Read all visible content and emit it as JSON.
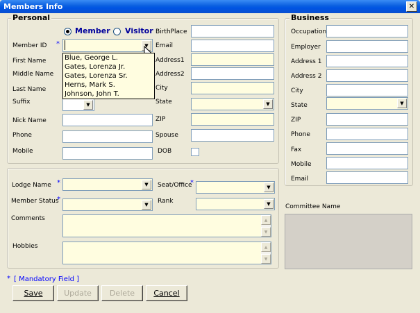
{
  "window": {
    "title": "Members Info",
    "close_glyph": "✕"
  },
  "personal": {
    "legend": "Personal",
    "radio_member": "Member",
    "radio_visitor": "Visitor",
    "labels": {
      "member_id": "Member ID",
      "first_name": "First Name",
      "middle_name": "Middle Name",
      "last_name": "Last Name",
      "suffix": "Suffix",
      "nick_name": "Nick Name",
      "phone": "Phone",
      "mobile": "Mobile",
      "birthplace": "BirthPlace",
      "email": "Email",
      "address1": "Address1",
      "address2": "Address2",
      "city": "City",
      "state": "State",
      "zip": "ZIP",
      "spouse": "Spouse",
      "dob": "DOB"
    },
    "member_id_options": [
      "Blue, George L.",
      "Gates, Lorenza  Jr.",
      "Gates, Lorenza  Sr.",
      "Herns, Mark S.",
      "Johnson, John T."
    ]
  },
  "business": {
    "legend": "Business",
    "labels": {
      "occupation": "Occupation",
      "employer": "Employer",
      "address1": "Address 1",
      "address2": "Address 2",
      "city": "City",
      "state": "State",
      "zip": "ZIP",
      "phone": "Phone",
      "fax": "Fax",
      "mobile": "Mobile",
      "email": "Email"
    }
  },
  "lodge": {
    "lodge_name": "Lodge Name",
    "member_status": "Member Status",
    "comments": "Comments",
    "hobbies": "Hobbies",
    "seat_office": "Seat/Office",
    "rank": "Rank"
  },
  "committee": {
    "label": "Committee Name"
  },
  "footer": {
    "mandatory_star": "*",
    "mandatory_text": "[ Mandatory Field ]",
    "buttons": {
      "save": "Save",
      "update": "Update",
      "delete": "Delete",
      "cancel": "Cancel"
    }
  },
  "required_marker": "*",
  "icons": {
    "dropdown_arrow": "▼",
    "scroll_up": "▲",
    "scroll_down": "▼"
  },
  "colors": {
    "titlebar": "#0054e3",
    "form_bg": "#ece9d8",
    "mandatory_field_bg": "#fffde0",
    "required_marker": "#0000ff"
  }
}
